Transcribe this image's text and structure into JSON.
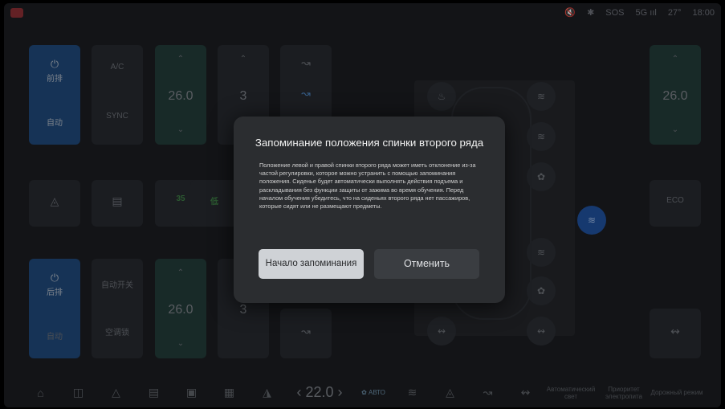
{
  "statusbar": {
    "sos": "SOS",
    "signal": "5G",
    "temperature": "27°",
    "time": "18:00",
    "icons": [
      "volume-mute-icon",
      "bluetooth-icon",
      "signal-icon"
    ]
  },
  "climate_left": {
    "front_power_label": "前排",
    "front_auto_label": "自动",
    "ac_label": "A/C",
    "sync_label": "SYNC",
    "temp_front": "26.0",
    "fan_front": "3",
    "rear_power_label": "后排",
    "rear_auto_label": "自动",
    "rear_auto_switch_label": "自动开关",
    "rear_ac_lock_label": "空调锁",
    "temp_rear": "26.0",
    "fan_rear": "3",
    "row_value_35": "35",
    "row_value_low": "低"
  },
  "climate_right": {
    "temp": "26.0",
    "eco_label": "ECO"
  },
  "dock": {
    "temp": "22.0",
    "auto_label": "АВТО",
    "auto_light_label": "Автоматический свет",
    "ev_priority_label": "Приоритет электропита",
    "road_mode_label": "Дорожный режим"
  },
  "dialog": {
    "title": "Запоминание положения спинки второго ряда",
    "body": "Положение левой и правой спинки второго ряда может иметь отклонение из-за частой регулировки, которое можно устранить с помощью запоминания положения. Сиденье будет автоматически выполнять действия подъема и раскладывания без функции защиты от зажима во время обучения. Перед началом обучения убедитесь, что на сиденьях второго ряда нет пассажиров, которые сидят или не размещают предметы.",
    "start_button": "Начало запоминания",
    "cancel_button": "Отменить"
  }
}
